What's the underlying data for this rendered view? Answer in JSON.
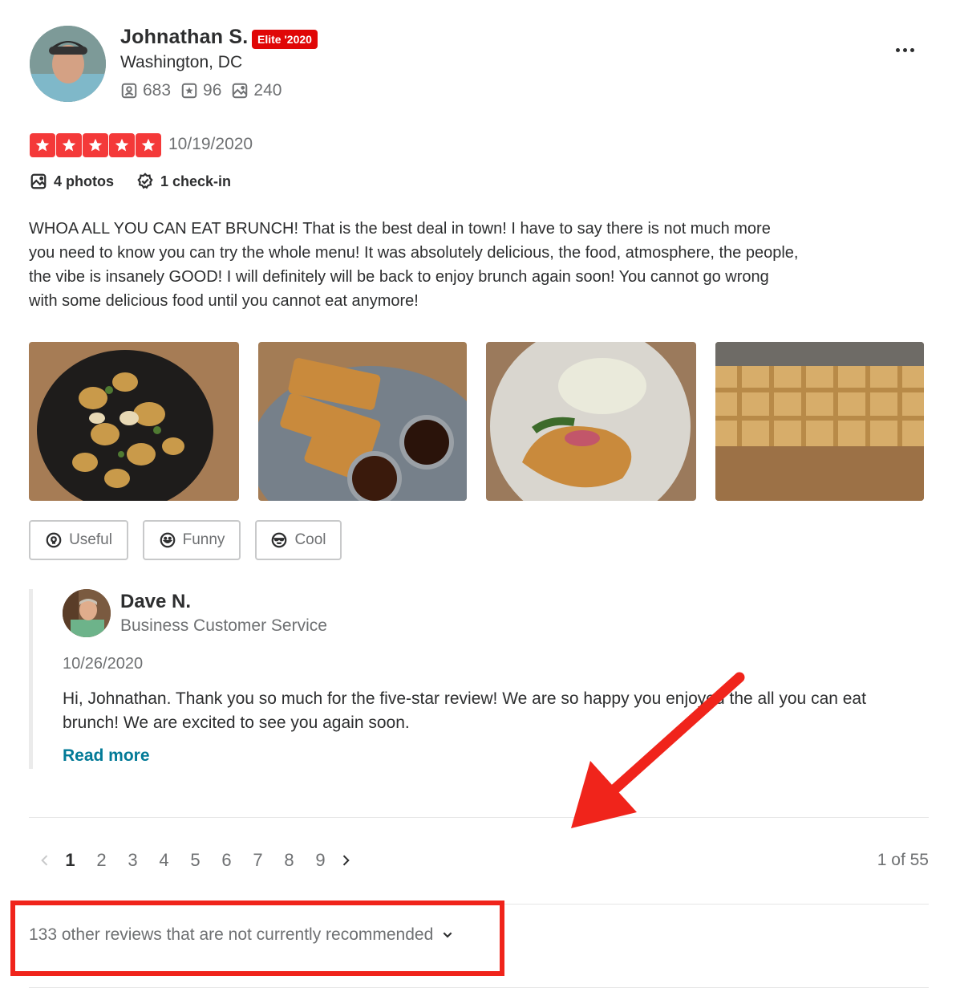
{
  "reviewer": {
    "name": "Johnathan S.",
    "elite_badge": "Elite '2020",
    "location": "Washington, DC",
    "stats": {
      "friends": "683",
      "reviews": "96",
      "photos": "240"
    }
  },
  "review": {
    "rating": 5,
    "date": "10/19/2020",
    "photos_label": "4 photos",
    "checkin_label": "1 check-in",
    "text": "WHOA ALL YOU CAN EAT BRUNCH! That is the best deal in town! I have to say there is not much more you need to know you can try the whole menu! It was absolutely delicious, the food, atmosphere, the people, the vibe is insanely GOOD! I will definitely will be back to enjoy brunch again soon! You cannot go wrong with some delicious food until you cannot eat anymore!"
  },
  "reactions": {
    "useful": "Useful",
    "funny": "Funny",
    "cool": "Cool"
  },
  "business_reply": {
    "name": "Dave N.",
    "role": "Business Customer Service",
    "date": "10/26/2020",
    "text": "Hi, Johnathan. Thank you so much for the five-star review! We are so happy you enjoyed the all you can eat brunch! We are excited to see you again soon.",
    "read_more": "Read more"
  },
  "pagination": {
    "pages": [
      "1",
      "2",
      "3",
      "4",
      "5",
      "6",
      "7",
      "8",
      "9"
    ],
    "current": "1",
    "count_label": "1 of 55"
  },
  "not_recommended_label": "133 other reviews that are not currently recommended",
  "colors": {
    "star_red": "#f43939",
    "elite_red": "#e00707",
    "link_teal": "#027a97",
    "annotation_red": "#f0241b"
  }
}
